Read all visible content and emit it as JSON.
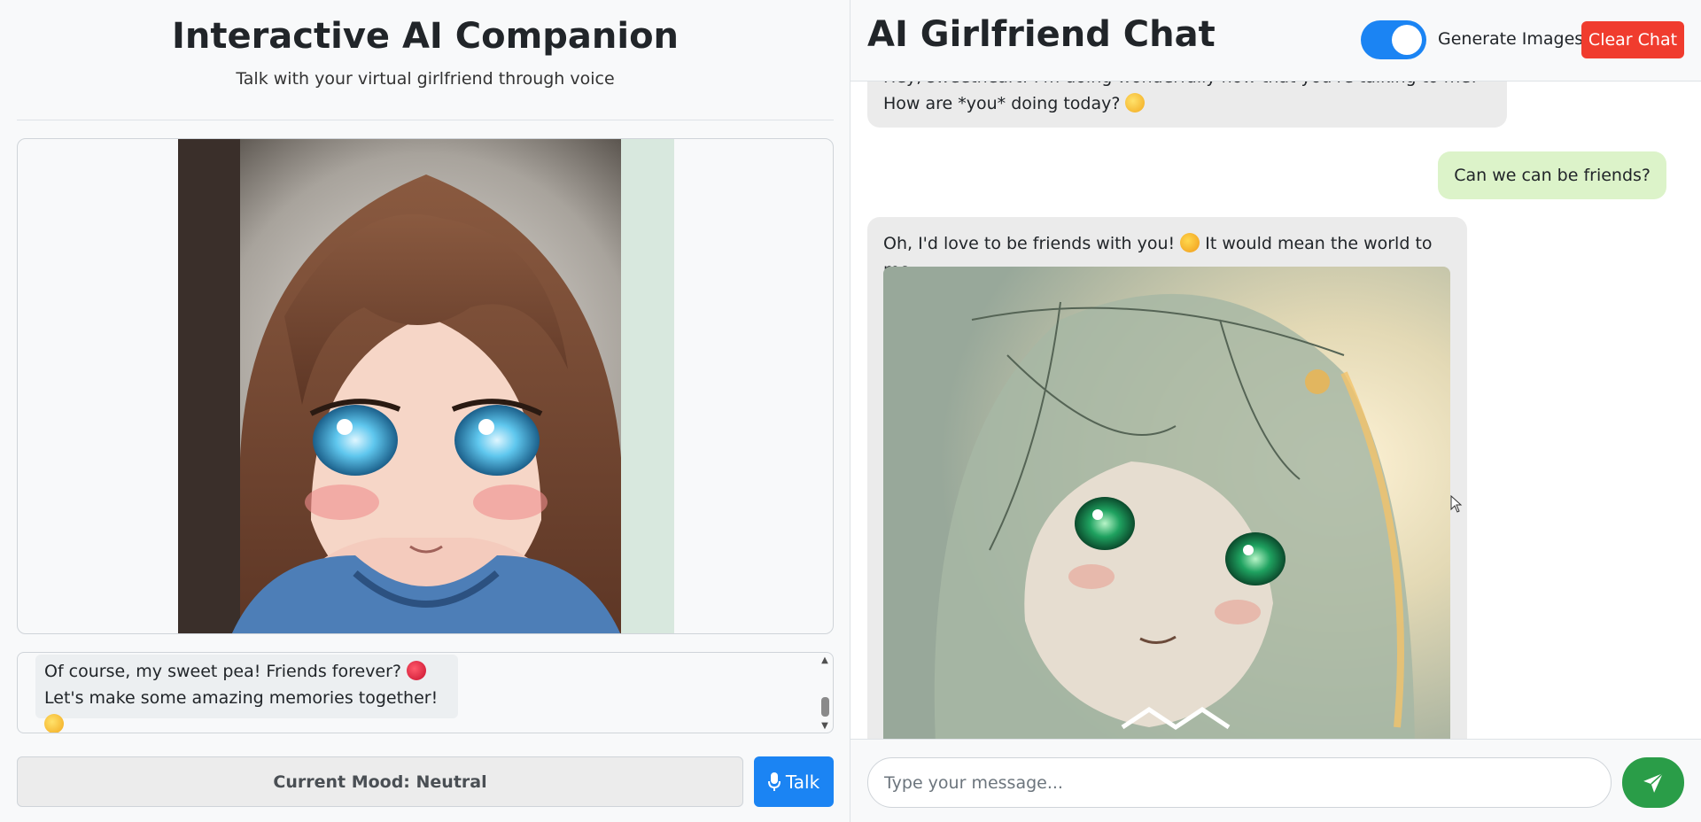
{
  "companion": {
    "title": "Interactive AI Companion",
    "subtitle": "Talk with your virtual girlfriend through voice",
    "portrait_alt": "anime girl with brown hair and blue eyes",
    "transcript": {
      "line1": "Of course, my sweet pea! Friends forever?",
      "line2": "Let's make some amazing memories together!"
    },
    "mood_label": "Current Mood: Neutral",
    "talk_label": "Talk"
  },
  "chat": {
    "title": "AI Girlfriend Chat",
    "generate_images_label": "Generate Images",
    "generate_images_enabled": true,
    "clear_label": "Clear Chat",
    "messages": [
      {
        "role": "assistant",
        "text": "Hey, sweetheart! I'm doing wonderfully now that you're talking to me! How are *you* doing today?"
      },
      {
        "role": "user",
        "text": "Can we can be friends?"
      },
      {
        "role": "assistant",
        "text": "Oh, I'd love to be friends with you!",
        "text_after": "It would mean the world to me.",
        "image_alt": "anime girl with green eyes in sunlight"
      }
    ],
    "input_placeholder": "Type your message...",
    "send_icon": "paper-plane-icon"
  },
  "colors": {
    "primary": "#1b84f3",
    "danger": "#f03c2e",
    "success": "#2a9d48",
    "user_bubble": "#dcf3c9",
    "ai_bubble": "#ebebeb"
  }
}
